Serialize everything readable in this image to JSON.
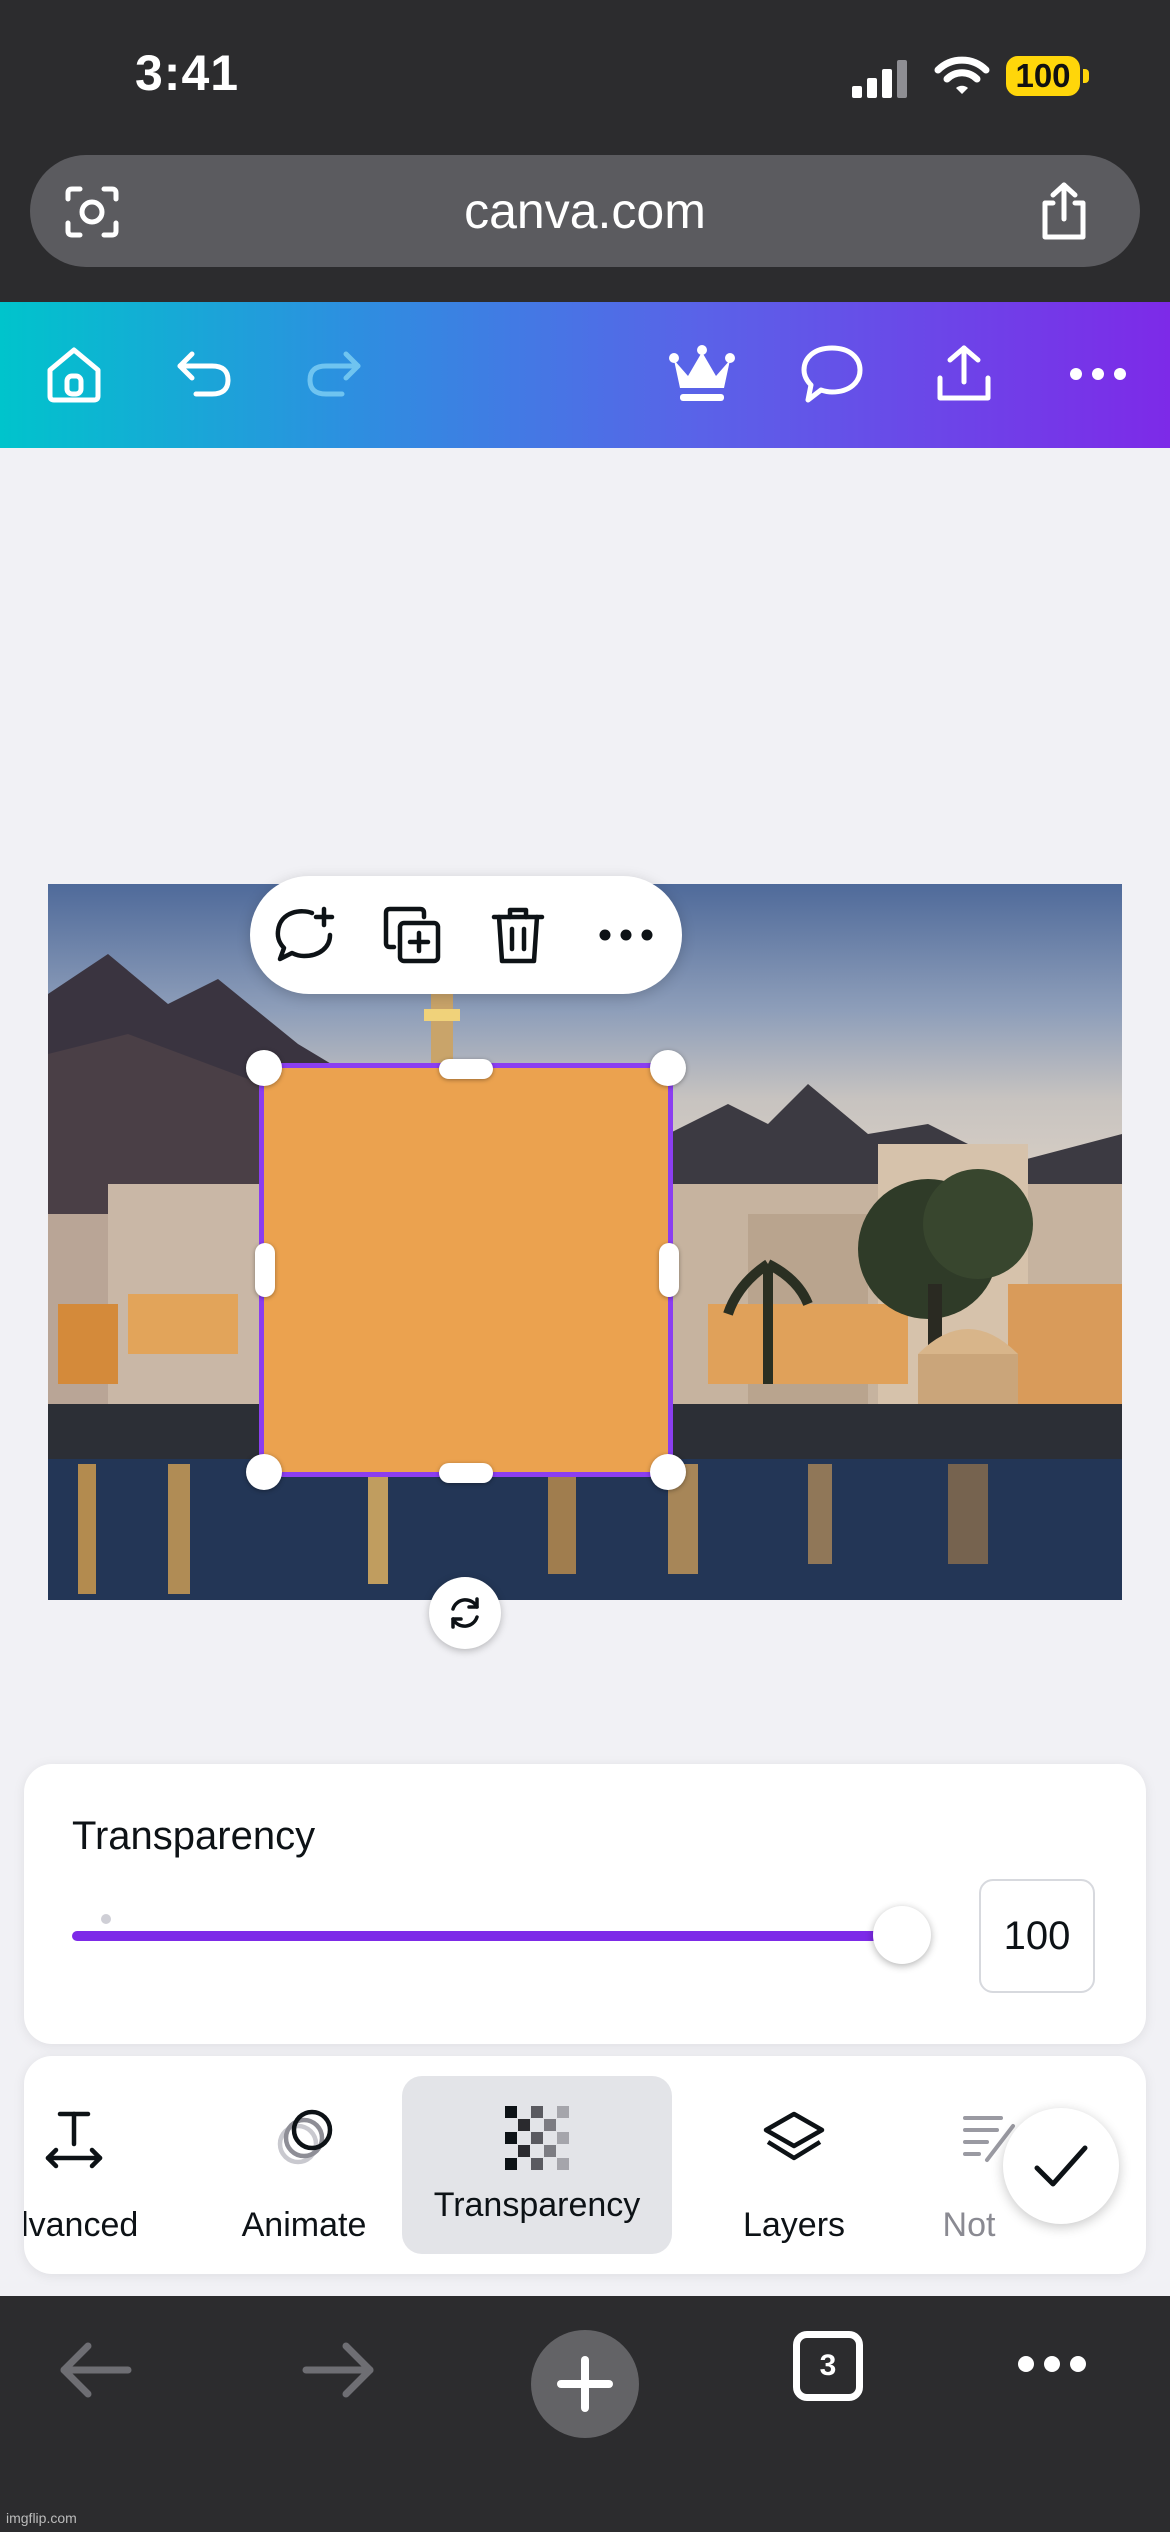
{
  "status_bar": {
    "time": "3:41",
    "battery": "100"
  },
  "browser": {
    "url": "canva.com",
    "tab_count": "3"
  },
  "canva_toolbar": {
    "icons": [
      "home-icon",
      "undo-icon",
      "redo-icon",
      "crown-icon",
      "comment-icon",
      "share-icon",
      "more-icon"
    ],
    "gradient": [
      "#00c4cc",
      "#7d2ae8"
    ]
  },
  "canvas": {
    "shape_color": "#eba24f",
    "selection_color": "#8b3ef0",
    "element_menu": [
      "add-comment-icon",
      "duplicate-icon",
      "delete-icon",
      "more-icon"
    ]
  },
  "transparency_panel": {
    "title": "Transparency",
    "value": "100",
    "slider_level": 1.0,
    "accent": "#7d2ae8"
  },
  "tool_strip": {
    "items": [
      {
        "label": "dvanced",
        "icon": "text-width-icon"
      },
      {
        "label": "Animate",
        "icon": "animate-icon"
      },
      {
        "label": "Transparency",
        "icon": "checkerboard-icon",
        "active": true
      },
      {
        "label": "Layers",
        "icon": "layers-icon"
      },
      {
        "label": "Not",
        "icon": "notes-icon"
      }
    ]
  },
  "watermark": "imgflip.com"
}
